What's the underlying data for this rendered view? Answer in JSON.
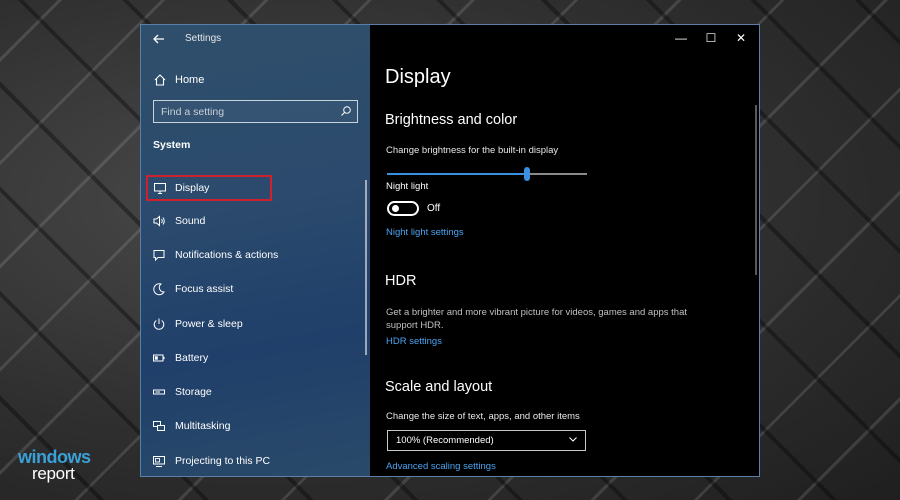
{
  "watermark": {
    "line1": "windows",
    "line2": "report"
  },
  "window": {
    "title": "Settings",
    "controls": {
      "minimize": "—",
      "maximize": "☐",
      "close": "✕"
    }
  },
  "sidebar": {
    "home_label": "Home",
    "search": {
      "placeholder": "Find a setting",
      "value": ""
    },
    "section": "System",
    "items": [
      {
        "label": "Display",
        "icon": "monitor-icon",
        "selected": true
      },
      {
        "label": "Sound",
        "icon": "speaker-icon"
      },
      {
        "label": "Notifications & actions",
        "icon": "notification-icon"
      },
      {
        "label": "Focus assist",
        "icon": "moon-icon"
      },
      {
        "label": "Power & sleep",
        "icon": "power-icon"
      },
      {
        "label": "Battery",
        "icon": "battery-icon"
      },
      {
        "label": "Storage",
        "icon": "storage-icon"
      },
      {
        "label": "Multitasking",
        "icon": "multitasking-icon"
      },
      {
        "label": "Projecting to this PC",
        "icon": "projecting-icon"
      }
    ]
  },
  "main": {
    "title": "Display",
    "brightness": {
      "heading": "Brightness and color",
      "slider_label": "Change brightness for the built-in display",
      "slider_value": 0.7,
      "night_light_label": "Night light",
      "night_light_state": "Off",
      "night_light_link": "Night light settings"
    },
    "hdr": {
      "heading": "HDR",
      "description": "Get a brighter and more vibrant picture for videos, games and apps that support HDR.",
      "link": "HDR settings"
    },
    "scale": {
      "heading": "Scale and layout",
      "label": "Change the size of text, apps, and other items",
      "selected": "100% (Recommended)",
      "link": "Advanced scaling settings"
    }
  },
  "colors": {
    "accent": "#3a8fe0",
    "link": "#4aa3f0",
    "highlight": "#d0202a"
  }
}
